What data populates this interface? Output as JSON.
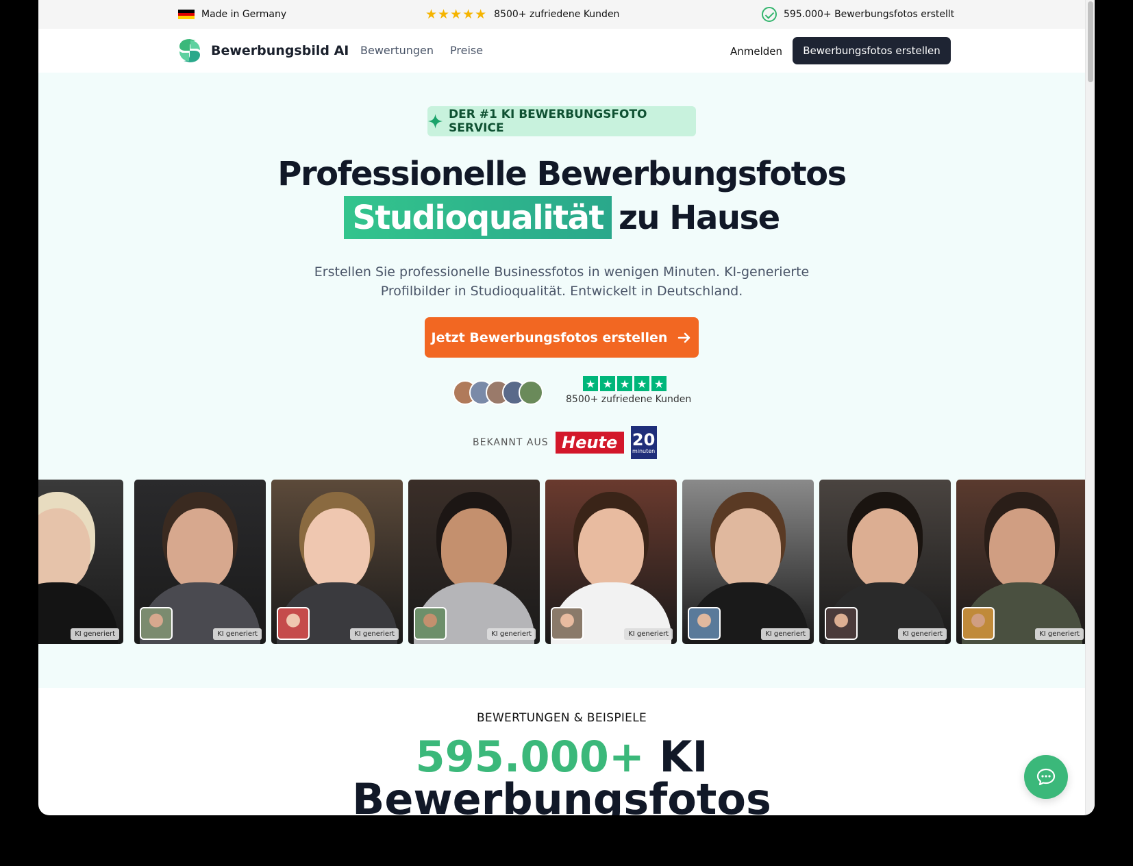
{
  "topbar": {
    "made_in": "Made in Germany",
    "stars": "★★★★★",
    "customers": "8500+ zufriedene Kunden",
    "photos_created": "595.000+ Bewerbungsfotos erstellt"
  },
  "nav": {
    "brand": "Bewerbungsbild AI",
    "links": [
      "Bewertungen",
      "Preise"
    ],
    "login": "Anmelden",
    "cta": "Bewerbungsfotos erstellen"
  },
  "hero": {
    "badge": "DER #1 KI BEWERBUNGSFOTO SERVICE",
    "title_line1": "Professionelle Bewerbungsfotos",
    "title_highlight": "Studioqualität",
    "title_rest": "zu Hause",
    "subtitle": "Erstellen Sie professionelle Businessfotos in wenigen Minuten. KI-generierte Profilbilder in Studioqualität. Entwickelt in Deutschland.",
    "cta": "Jetzt Bewerbungsfotos erstellen",
    "trust_text": "8500+ zufriedene Kunden",
    "trust_star": "★",
    "press_label": "BEKANNT AUS",
    "press_heute": "Heute",
    "press_20": "20",
    "press_20_sub": "minuten"
  },
  "gallery": {
    "tag": "KI generiert",
    "photos": [
      {
        "bg": "#3a3a3a",
        "skin": "#e6c3aa",
        "hair": "#e8dcc0",
        "body": "#141414",
        "thumb": null
      },
      {
        "bg": "#2a2a2c",
        "skin": "#d7a88e",
        "hair": "#3a2a20",
        "body": "#4a4a50",
        "thumb": "#7b8b6f"
      },
      {
        "bg": "#5c4a3a",
        "skin": "#efc7b0",
        "hair": "#8a6a40",
        "body": "#3a3a3e",
        "thumb": "#c54b4b"
      },
      {
        "bg": "#3a2e28",
        "skin": "#c4906e",
        "hair": "#1c1614",
        "body": "#b5b5b8",
        "thumb": "#6d8f6a"
      },
      {
        "bg": "#6a3a2e",
        "skin": "#e8bba0",
        "hair": "#3a2418",
        "body": "#f2f2f2",
        "thumb": "#8a7a6a"
      },
      {
        "bg": "#8a8a8a",
        "skin": "#e0b89e",
        "hair": "#5a3a24",
        "body": "#1a1a1a",
        "thumb": "#5a7a9a"
      },
      {
        "bg": "#4a4440",
        "skin": "#dcae92",
        "hair": "#1a1410",
        "body": "#2a2a2a",
        "thumb": "#4a3a3a"
      },
      {
        "bg": "#5a3a2e",
        "skin": "#d09e82",
        "hair": "#2a1e18",
        "body": "#4a5040",
        "thumb": "#c08a3a"
      }
    ]
  },
  "reviews": {
    "label": "BEWERTUNGEN & BEISPIELE",
    "count": "595.000+",
    "count_rest": "KI",
    "line2": "Bewerbungsfotos"
  },
  "colors": {
    "accent_green": "#3bb87a",
    "cta_orange": "#f26722",
    "dark": "#1e2433"
  }
}
